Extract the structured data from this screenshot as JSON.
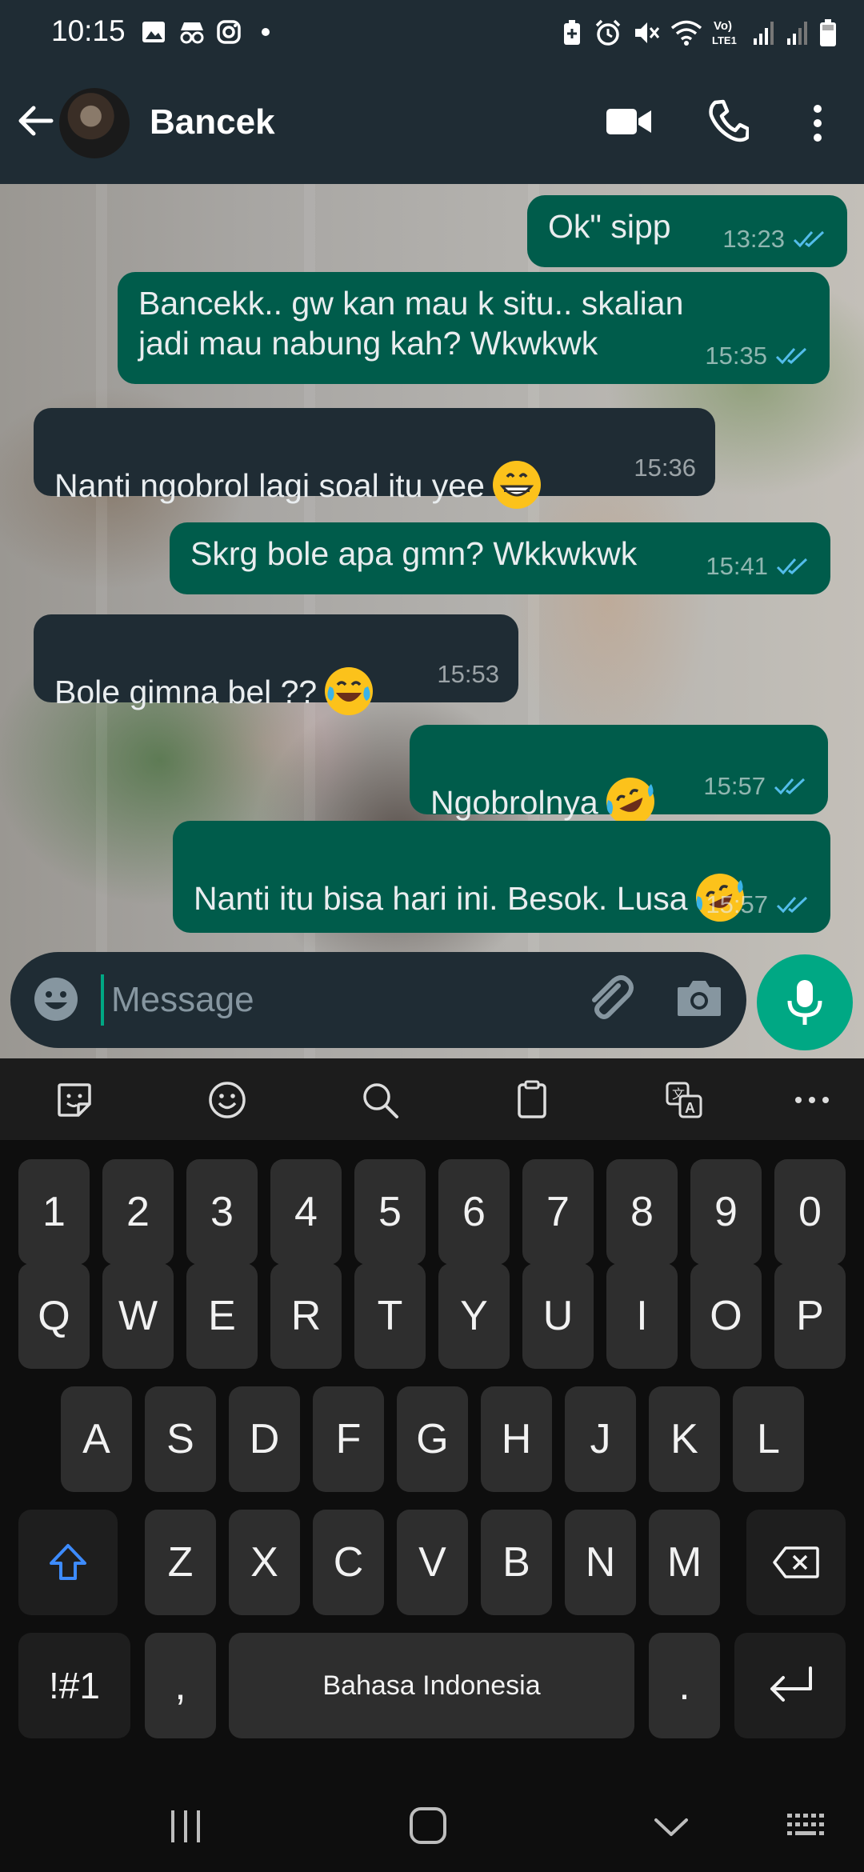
{
  "status_bar": {
    "time": "10:15"
  },
  "header": {
    "contact_name": "Bancek"
  },
  "messages": [
    {
      "direction": "out",
      "text": "Ok\" sipp",
      "time": "13:23",
      "read": true
    },
    {
      "direction": "out",
      "text": "Bancekk.. gw kan mau k situ.. skalian\njadi mau nabung kah? Wkwkwk",
      "time": "15:35",
      "read": true
    },
    {
      "direction": "in",
      "text": "Nanti ngobrol lagi soal itu yee",
      "emoji": "grinning-face-icon",
      "time": "15:36"
    },
    {
      "direction": "out",
      "text": "Skrg bole apa gmn? Wkkwkwk",
      "time": "15:41",
      "read": true
    },
    {
      "direction": "in",
      "text": "Bole gimna bel ??",
      "emoji": "tears-of-joy-icon",
      "time": "15:53"
    },
    {
      "direction": "out",
      "text": "Ngobrolnya",
      "emoji": "rolling-laughing-icon",
      "time": "15:57",
      "read": true
    },
    {
      "direction": "out",
      "text": "Nanti itu bisa hari ini. Besok. Lusa",
      "emoji": "rolling-laughing-icon",
      "time": "15:57",
      "read": true
    }
  ],
  "composer": {
    "placeholder": "Message",
    "value": ""
  },
  "keyboard": {
    "toolbar": [
      "sticker-icon",
      "emoji-icon",
      "search-icon",
      "clipboard-icon",
      "translate-icon",
      "more-icon"
    ],
    "row_numbers": [
      "1",
      "2",
      "3",
      "4",
      "5",
      "6",
      "7",
      "8",
      "9",
      "0"
    ],
    "row_1": [
      "Q",
      "W",
      "E",
      "R",
      "T",
      "Y",
      "U",
      "I",
      "O",
      "P"
    ],
    "row_2": [
      "A",
      "S",
      "D",
      "F",
      "G",
      "H",
      "J",
      "K",
      "L"
    ],
    "row_3": [
      "Z",
      "X",
      "C",
      "V",
      "B",
      "N",
      "M"
    ],
    "symbols_label": "!#1",
    "comma_label": ",",
    "space_label": "Bahasa Indonesia",
    "period_label": "."
  },
  "colors": {
    "outgoing_bubble": "#005c4b",
    "incoming_bubble": "#1f2c34",
    "accent": "#00a884",
    "read_ticks": "#53bdeb",
    "shift_accent": "#3d8bfd"
  }
}
